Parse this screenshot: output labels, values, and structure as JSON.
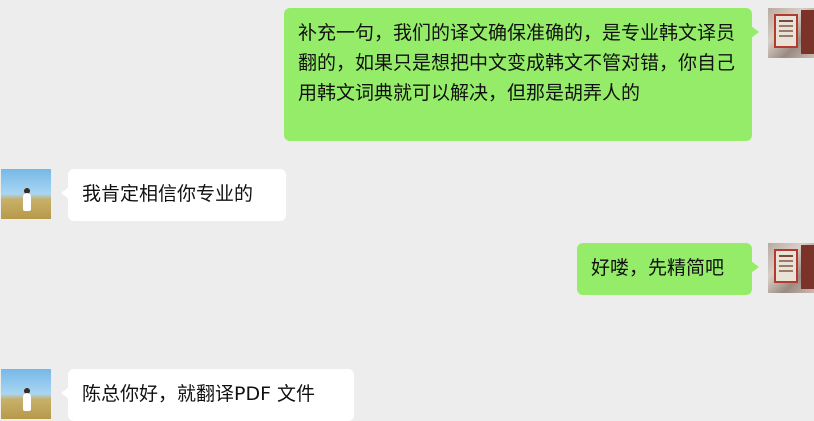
{
  "messages": [
    {
      "side": "right",
      "text": "补充一句，我们的译文确保准确的，是专业韩文译员翻的，如果只是想把中文变成韩文不管对错，你自己用韩文词典就可以解决，但那是胡弄人的"
    },
    {
      "side": "left",
      "text": "我肯定相信你专业的"
    },
    {
      "side": "right",
      "text": "好喽，先精简吧"
    },
    {
      "side": "left",
      "text": "陈总你好，就翻译PDF 文件"
    }
  ],
  "colors": {
    "background": "#ededed",
    "sent_bubble": "#95ec69",
    "received_bubble": "#ffffff",
    "text": "#111111"
  }
}
